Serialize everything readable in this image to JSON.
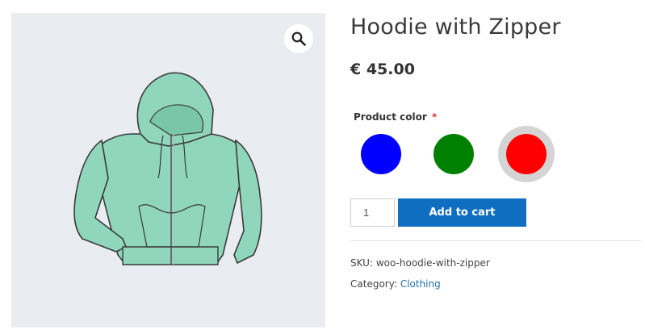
{
  "gallery": {
    "image_alt": "Hoodie with Zipper",
    "zoom_icon": "magnifier-icon"
  },
  "product": {
    "title": "Hoodie with Zipper",
    "price": "€ 45.00"
  },
  "attribute": {
    "label": "Product color",
    "required_mark": "*",
    "swatches": [
      {
        "name": "blue",
        "color": "#0000ff",
        "selected": false
      },
      {
        "name": "green",
        "color": "#008000",
        "selected": false
      },
      {
        "name": "red",
        "color": "#ff0000",
        "selected": true
      }
    ]
  },
  "cart": {
    "quantity": "1",
    "add_to_cart_label": "Add to cart"
  },
  "meta": {
    "sku_label": "SKU:",
    "sku_value": "woo-hoodie-with-zipper",
    "category_label": "Category:",
    "category_value": "Clothing"
  },
  "colors": {
    "accent_button": "#0f6ebf",
    "link": "#2271b1",
    "required": "#d63638",
    "gallery_bg": "#e9edf1",
    "hoodie": "#8fd6bd"
  }
}
